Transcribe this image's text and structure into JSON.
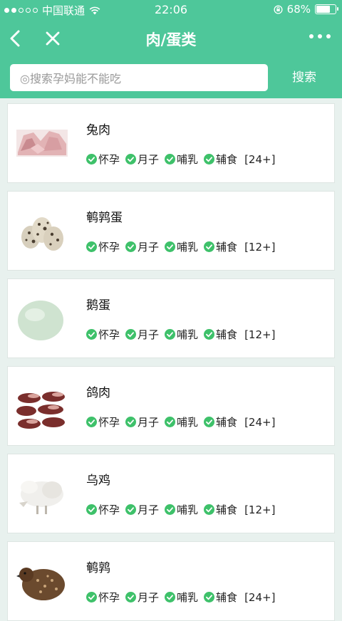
{
  "status_bar": {
    "carrier": "中国联通",
    "time": "22:06",
    "battery": "68%",
    "battery_level": 0.68
  },
  "navbar": {
    "title": "肉/蛋类",
    "back_icon": "back-chevron-icon",
    "close_icon": "close-icon",
    "more_icon": "more-dots-icon"
  },
  "search": {
    "placeholder": "◎搜索孕妈能不能吃",
    "button_label": "搜索"
  },
  "colors": {
    "header": "#4ec79a",
    "check": "#3ec16a",
    "background": "#e8f1ee"
  },
  "tag_labels": [
    "怀孕",
    "月子",
    "哺乳",
    "辅食"
  ],
  "items": [
    {
      "name": "兔肉",
      "age": "[24+]",
      "image": "rabbit-meat"
    },
    {
      "name": "鹌鹑蛋",
      "age": "[12+]",
      "image": "quail-eggs"
    },
    {
      "name": "鹅蛋",
      "age": "[12+]",
      "image": "goose-egg"
    },
    {
      "name": "鸽肉",
      "age": "[24+]",
      "image": "pigeon-meat"
    },
    {
      "name": "乌鸡",
      "age": "[12+]",
      "image": "silkie-chicken"
    },
    {
      "name": "鹌鹑",
      "age": "[24+]",
      "image": "quail-bird"
    }
  ]
}
